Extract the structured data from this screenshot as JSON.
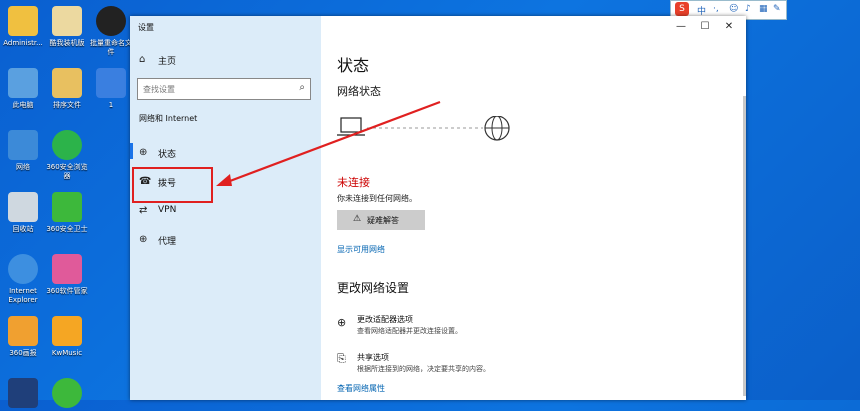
{
  "desktop": {
    "icons": [
      {
        "label": "Administr...",
        "color": "#f0c040"
      },
      {
        "label": "酷我装机版",
        "color": "#ecd9a0"
      },
      {
        "label": "批量重命名文件",
        "color": "#222222"
      },
      {
        "label": "此电脑",
        "color": "#5aa0e0"
      },
      {
        "label": "排序文件",
        "color": "#e8c060"
      },
      {
        "label": "1",
        "color": "#3a7fe0"
      },
      {
        "label": "网络",
        "color": "#3c8ad8"
      },
      {
        "label": "360安全浏览器",
        "color": "#2cb34a"
      },
      {
        "label": "回收站",
        "color": "#cfd8e0"
      },
      {
        "label": "360安全卫士",
        "color": "#3db83b"
      },
      {
        "label": "Internet Explorer",
        "color": "#3d8fe0"
      },
      {
        "label": "360软件管家",
        "color": "#e05a9a"
      },
      {
        "label": "360画报",
        "color": "#f0a030"
      },
      {
        "label": "KwMusic",
        "color": "#f5a623"
      }
    ]
  },
  "ime": {
    "logo": "S",
    "items": [
      "中",
      "·,",
      "☺",
      "♪",
      "▦",
      "✎"
    ]
  },
  "window": {
    "title": "设置",
    "controls": {
      "minimize": "—",
      "maximize": "☐",
      "close": "✕"
    },
    "search_placeholder": "查找设置",
    "home_label": "主页",
    "section_heading": "网络和 Internet",
    "nav": [
      {
        "icon": "⊕",
        "label": "状态"
      },
      {
        "icon": "☎",
        "label": "拨号"
      },
      {
        "icon": "⇄",
        "label": "VPN"
      },
      {
        "icon": "⊕",
        "label": "代理"
      }
    ],
    "main": {
      "title": "状态",
      "subtitle": "网络状态",
      "status": "未连接",
      "status_desc": "你未连接到任何网络。",
      "troubleshoot": "疑难解答",
      "show_networks": "显示可用网络",
      "change_heading": "更改网络设置",
      "options": [
        {
          "title": "更改适配器选项",
          "desc": "查看网络适配器并更改连接设置。"
        },
        {
          "title": "共享选项",
          "desc": "根据所连接到的网络，决定要共享的内容。"
        }
      ],
      "view_props": "查看网络属性"
    }
  },
  "colors": {
    "accent": "#0063b1",
    "error": "#cc0000",
    "annotation": "#e02020"
  }
}
